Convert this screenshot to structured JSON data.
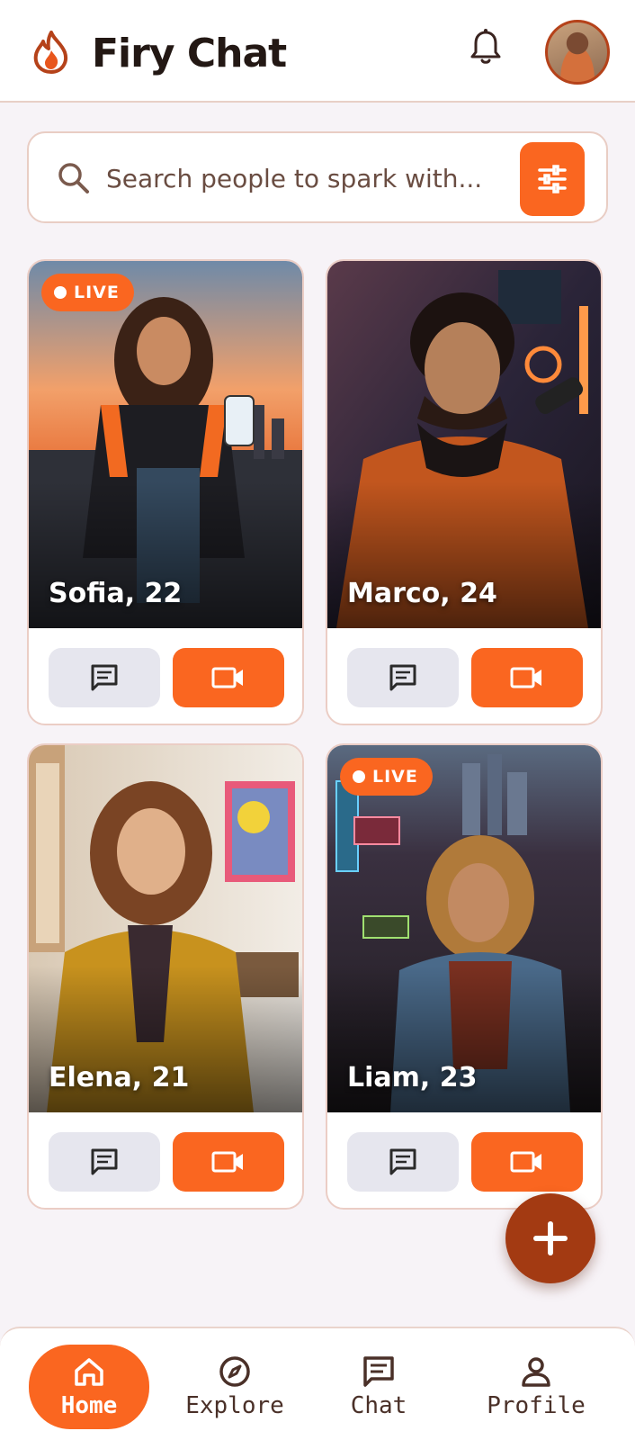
{
  "header": {
    "app_title": "Firy Chat",
    "icons": [
      "flame-icon",
      "bell-icon",
      "avatar"
    ]
  },
  "search": {
    "placeholder": "Search people to spark with...",
    "filter_icon": "sliders-icon"
  },
  "cards": [
    {
      "name": "Sofia, 22",
      "live": true,
      "live_label": "LIVE"
    },
    {
      "name": "Marco, 24",
      "live": false
    },
    {
      "name": "Elena, 21",
      "live": false
    },
    {
      "name": "Liam, 23",
      "live": true,
      "live_label": "LIVE"
    }
  ],
  "nav": {
    "items": [
      {
        "label": "Home",
        "icon": "home-icon",
        "active": true
      },
      {
        "label": "Explore",
        "icon": "compass-icon",
        "active": false
      },
      {
        "label": "Chat",
        "icon": "chat-icon",
        "active": false
      },
      {
        "label": "Profile",
        "icon": "person-icon",
        "active": false
      }
    ]
  },
  "colors": {
    "accent": "#fa6620",
    "fab": "#a33a12",
    "background": "#f7f3f7",
    "chat_button": "#e6e6ee"
  }
}
